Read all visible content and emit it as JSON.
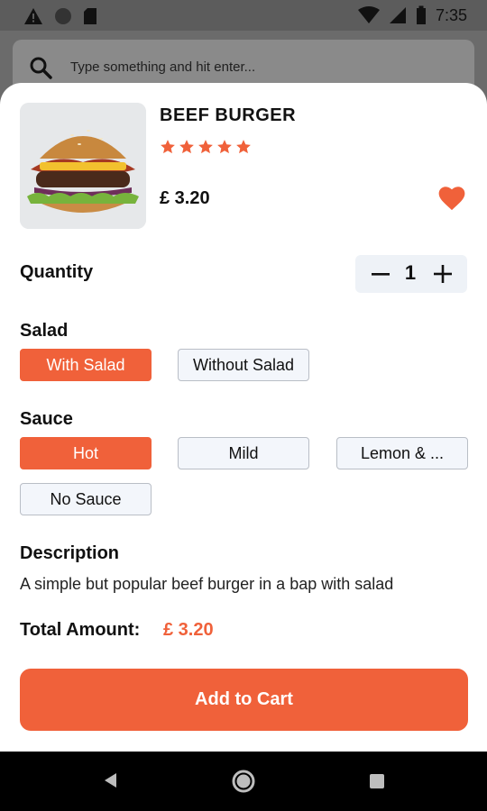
{
  "status_bar": {
    "time": "7:35"
  },
  "search": {
    "placeholder": "Type something and hit enter..."
  },
  "product": {
    "name": "BEEF BURGER",
    "rating": 5,
    "price": "£ 3.20",
    "favorite": true
  },
  "quantity": {
    "label": "Quantity",
    "value": "1"
  },
  "salad": {
    "label": "Salad",
    "options": [
      {
        "label": "With Salad",
        "selected": true
      },
      {
        "label": "Without Salad",
        "selected": false
      }
    ]
  },
  "sauce": {
    "label": "Sauce",
    "options": [
      {
        "label": "Hot",
        "selected": true
      },
      {
        "label": "Mild",
        "selected": false
      },
      {
        "label": "Lemon & ...",
        "selected": false
      },
      {
        "label": "No Sauce",
        "selected": false
      }
    ]
  },
  "description": {
    "label": "Description",
    "text": "A simple but popular beef burger in a bap with salad"
  },
  "total": {
    "label": "Total Amount:",
    "value": "£ 3.20"
  },
  "cart_button": {
    "label": "Add to Cart"
  },
  "colors": {
    "accent": "#f0613a",
    "option_unselected_bg": "#f3f6fb"
  }
}
